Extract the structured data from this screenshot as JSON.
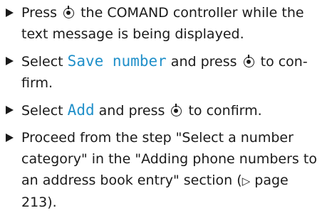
{
  "steps": [
    {
      "part1": "Press",
      "part2": "the COMAND controller while the text message is being displayed."
    },
    {
      "pre": "Select",
      "term": "Save number",
      "mid": "and press",
      "post": "to con- firm."
    },
    {
      "pre": "Select",
      "term": "Add",
      "mid": "and press",
      "post": "to confirm."
    },
    {
      "text": "Proceed from the step \"Select a number category\" in the \"Adding phone numbers to an address book entry\" section",
      "ref_arrow": "▷",
      "ref_text": "page 213",
      "ref_open": "(",
      "ref_close": ")."
    }
  ],
  "icons": {
    "bullet": "triangle-right-icon",
    "controller": "press-controller-icon"
  },
  "colors": {
    "ui_term": "#1f8fc9",
    "text": "#1a1a1a"
  }
}
